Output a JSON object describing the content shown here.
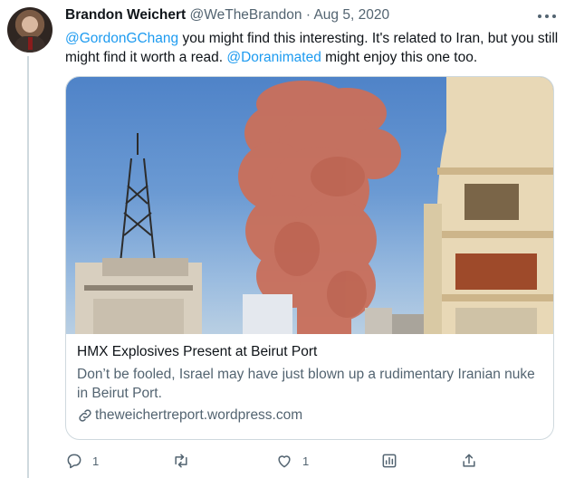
{
  "tweet": {
    "author_name": "Brandon Weichert",
    "author_handle": "@WeTheBrandon",
    "separator": "·",
    "date": "Aug 5, 2020",
    "text_parts": {
      "mention_1": "@GordonGChang",
      "body_1": " you might find this interesting. It's related to Iran, but you still might find it worth a read. ",
      "mention_2": "@Doranimated",
      "body_2": " might enjoy this one too."
    }
  },
  "card": {
    "title": "HMX Explosives Present at Beirut Port",
    "description": "Don’t be fooled, Israel may have just blown up a rudimentary Iranian nuke in Beirut Port.",
    "link": "theweichertreport.wordpress.com"
  },
  "actions": {
    "reply_count": "1",
    "retweet_count": "",
    "like_count": "1"
  },
  "icons": {
    "more": "more-icon",
    "reply": "reply-icon",
    "retweet": "retweet-icon",
    "like": "like-icon",
    "analytics": "analytics-icon",
    "share": "share-icon",
    "link": "link-icon"
  },
  "colors": {
    "accent": "#1d9bf0",
    "secondary_text": "#536471",
    "border": "#cfd9de"
  }
}
